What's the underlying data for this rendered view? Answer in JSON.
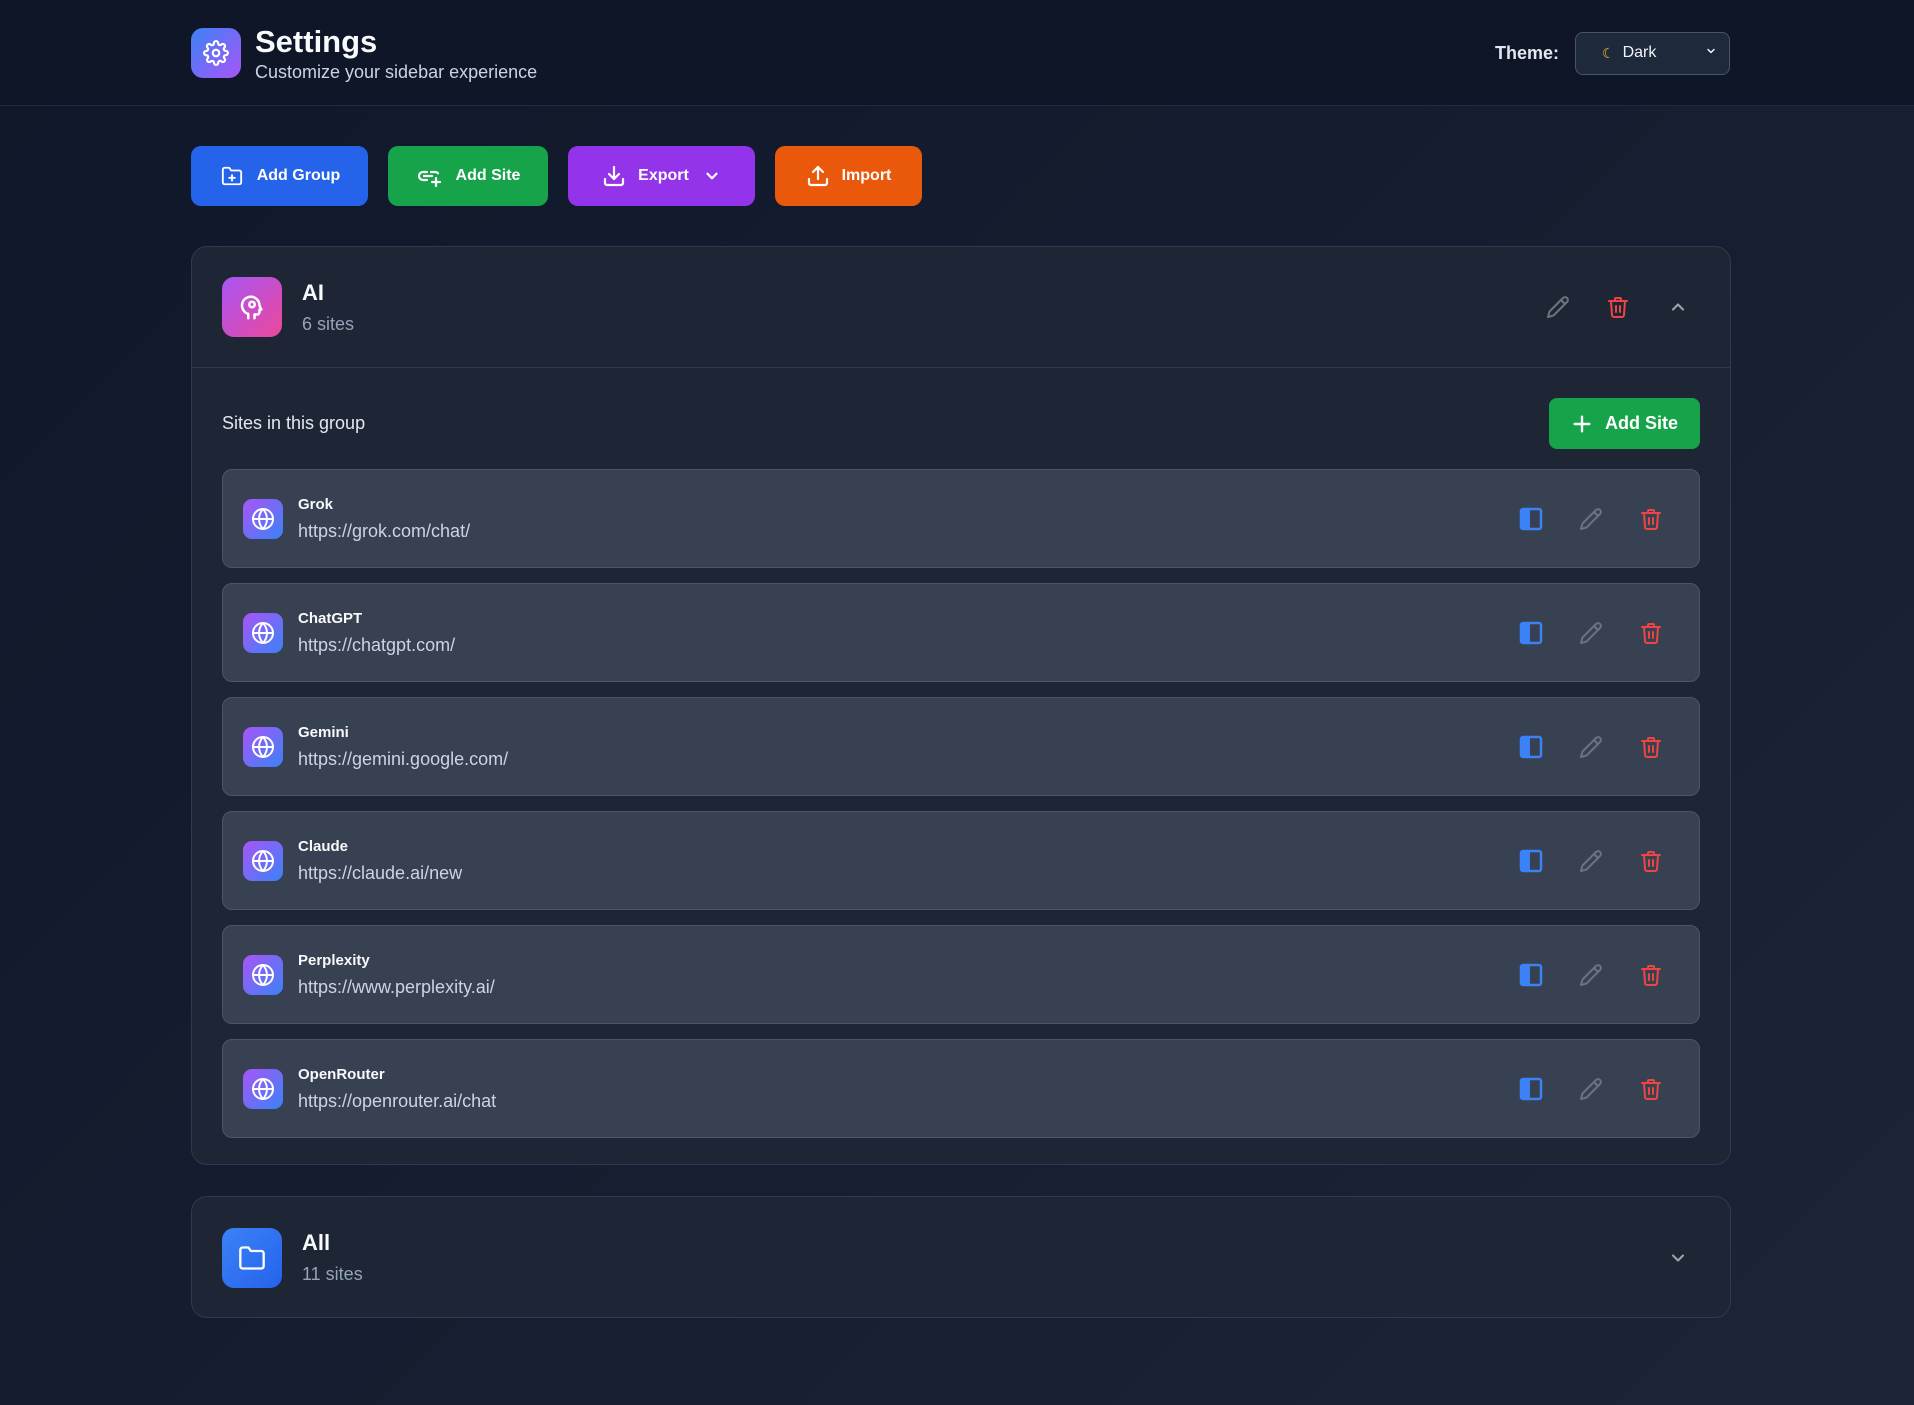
{
  "header": {
    "title": "Settings",
    "subtitle": "Customize your sidebar experience",
    "theme_label": "Theme:",
    "theme_value": "Dark"
  },
  "toolbar": {
    "add_group": "Add Group",
    "add_site": "Add Site",
    "export": "Export",
    "import": "Import"
  },
  "groups": [
    {
      "name": "AI",
      "count": "6 sites",
      "expanded": true,
      "sites_label": "Sites in this group",
      "add_site_label": "Add Site",
      "sites": [
        {
          "name": "Grok",
          "url": "https://grok.com/chat/"
        },
        {
          "name": "ChatGPT",
          "url": "https://chatgpt.com/"
        },
        {
          "name": "Gemini",
          "url": "https://gemini.google.com/"
        },
        {
          "name": "Claude",
          "url": "https://claude.ai/new"
        },
        {
          "name": "Perplexity",
          "url": "https://www.perplexity.ai/"
        },
        {
          "name": "OpenRouter",
          "url": "https://openrouter.ai/chat"
        }
      ]
    },
    {
      "name": "All",
      "count": "11 sites",
      "expanded": false
    }
  ],
  "colors": {
    "accent_blue": "#2563eb",
    "accent_green": "#16a34a",
    "accent_purple": "#9333ea",
    "accent_orange": "#ea580c",
    "danger_red": "#ef4444"
  },
  "icons": {
    "app": "gear-icon",
    "ai_group": "brain-icon",
    "all_group": "folder-icon",
    "site": "globe-icon",
    "open_sidebar": "sidebar-panel-icon",
    "edit": "pencil-icon",
    "delete": "trash-icon"
  }
}
